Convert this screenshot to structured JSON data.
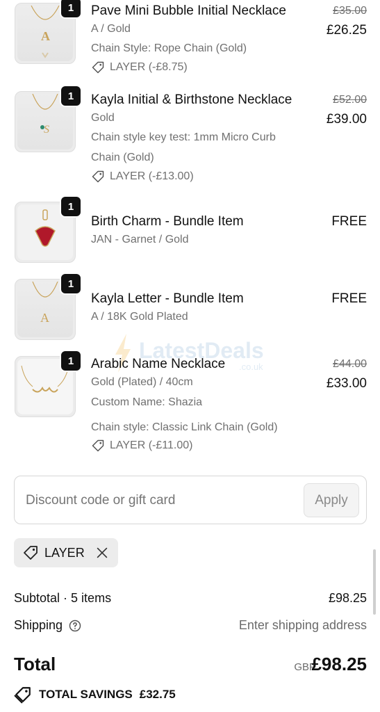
{
  "items": [
    {
      "name": "Pave Mini Bubble Initial Necklace",
      "variant": "A / Gold",
      "details": [
        "Chain Style: Rope Chain (Gold)"
      ],
      "discount": "LAYER (-£8.75)",
      "original_price": "£35.00",
      "price": "£26.25",
      "quantity": "1"
    },
    {
      "name": "Kayla Initial & Birthstone Necklace",
      "variant": "Gold",
      "details": [
        "Chain style key test: 1mm Micro Curb",
        "Chain (Gold)"
      ],
      "discount": "LAYER (-£13.00)",
      "original_price": "£52.00",
      "price": "£39.00",
      "quantity": "1"
    },
    {
      "name": "Birth Charm - Bundle Item",
      "variant": "JAN - Garnet / Gold",
      "price": "FREE",
      "quantity": "1"
    },
    {
      "name": "Kayla Letter - Bundle Item",
      "variant": "A / 18K Gold Plated",
      "price": "FREE",
      "quantity": "1"
    },
    {
      "name": "Arabic Name Necklace",
      "variant": "Gold (Plated) / 40cm",
      "details": [
        "Custom Name: Shazia",
        "Chain style: Classic Link Chain (Gold)"
      ],
      "discount": "LAYER (-£11.00)",
      "original_price": "£44.00",
      "price": "£33.00",
      "quantity": "1"
    }
  ],
  "discount_field": {
    "placeholder": "Discount code or gift card",
    "apply_label": "Apply"
  },
  "applied_code": "LAYER",
  "summary": {
    "subtotal_label": "Subtotal · 5 items",
    "subtotal_value": "£98.25",
    "shipping_label": "Shipping",
    "shipping_value": "Enter shipping address",
    "total_label": "Total",
    "currency": "GBP",
    "total_value": "£98.25",
    "savings_label": "TOTAL SAVINGS",
    "savings_value": "£32.75"
  },
  "watermark": {
    "text": "LatestDeals",
    "sub": ".co.uk"
  },
  "colors": {
    "text": "#111111",
    "muted": "#707070",
    "badge": "#111111",
    "garnet": "#b0182a",
    "gold": "#c9a45c"
  },
  "icons": [
    "tag-icon",
    "close-icon",
    "help-circle-icon",
    "savings-tag-icon"
  ]
}
